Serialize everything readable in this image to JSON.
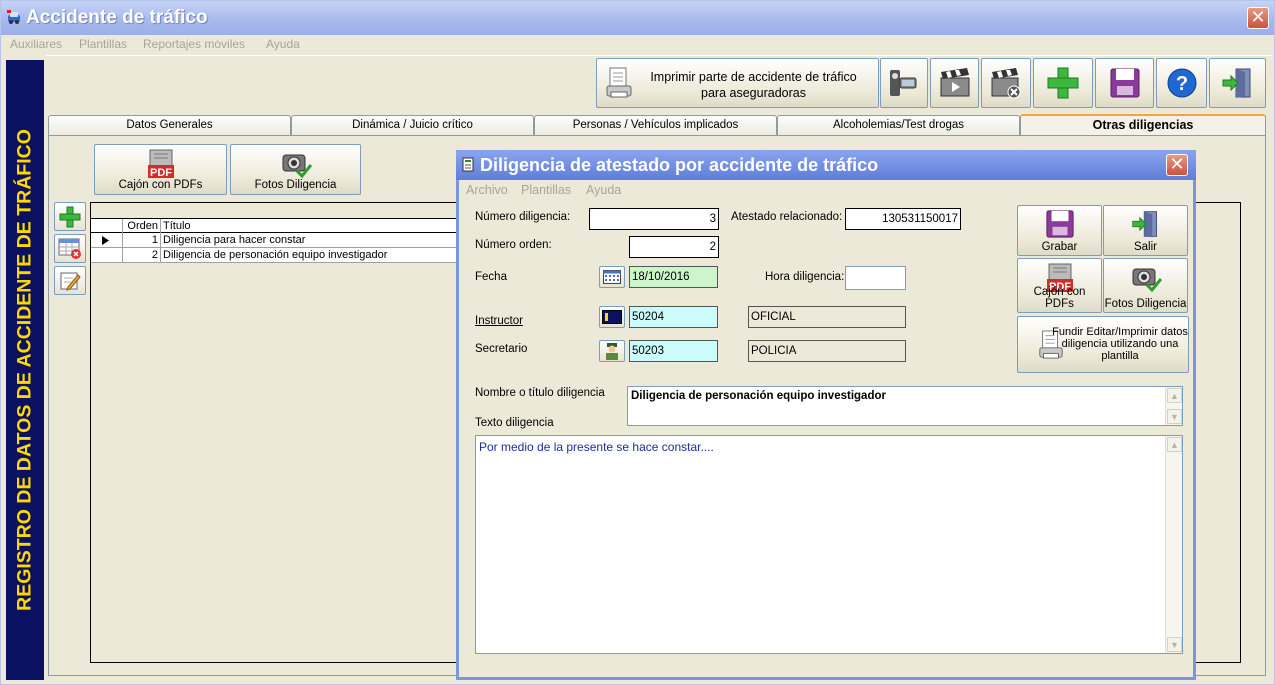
{
  "window": {
    "title": "Accidente de tráfico",
    "close_label": "✕"
  },
  "menu": [
    "Auxiliares",
    "Plantillas",
    "Reportajes móviles",
    "Ayuda"
  ],
  "sidebar": {
    "text": "REGISTRO DE DATOS DE ACCIDENTE DE TRÁFICO"
  },
  "toolbar": {
    "print_line1": "Imprimir parte de accidente de tráfico",
    "print_line2": "para aseguradoras"
  },
  "tabs": [
    {
      "label": "Datos Generales",
      "active": false
    },
    {
      "label": "Dinámica / Juicio crítico",
      "active": false
    },
    {
      "label": "Personas / Vehículos implicados",
      "active": false
    },
    {
      "label": "Alcoholemias/Test drogas",
      "active": false
    },
    {
      "label": "Otras diligencias",
      "active": true
    }
  ],
  "panel": {
    "pdf_button": "Cajón con PDFs",
    "photos_button": "Fotos Diligencia"
  },
  "grid": {
    "columns": [
      "Orden",
      "Título"
    ],
    "rows": [
      {
        "orden": "1",
        "titulo": "Diligencia para hacer constar"
      },
      {
        "orden": "2",
        "titulo": "Diligencia de personación equipo investigador"
      }
    ]
  },
  "dialog": {
    "title": "Diligencia de atestado por accidente de tráfico",
    "close_label": "✕",
    "menu": [
      "Archivo",
      "Plantillas",
      "Ayuda"
    ],
    "numero_diligencia_label": "Número diligencia:",
    "numero_diligencia": "3",
    "atestado_label": "Atestado relacionado:",
    "atestado": "130531150017",
    "numero_orden_label": "Número orden:",
    "numero_orden": "2",
    "fecha_label": "Fecha",
    "fecha": "18/10/2016",
    "hora_label": "Hora diligencia:",
    "hora": "",
    "instructor_label": "Instructor",
    "instructor_id": "50204",
    "instructor_cargo": "OFICIAL",
    "secretario_label": "Secretario",
    "secretario_id": "50203",
    "secretario_cargo": "POLICIA",
    "nombre_label": "Nombre o título diligencia",
    "nombre": "Diligencia de personación equipo investigador",
    "texto_label": "Texto diligencia",
    "texto": "Por medio de la  presente se hace constar....",
    "buttons": {
      "grabar": "Grabar",
      "salir": "Salir",
      "pdfs": "Cajón con PDFs",
      "fotos": "Fotos Diligencia",
      "fundir_line1": "Fundir Editar/Imprimir datos",
      "fundir_line2": "diligencia utilizando una",
      "fundir_line3": "plantilla"
    }
  }
}
